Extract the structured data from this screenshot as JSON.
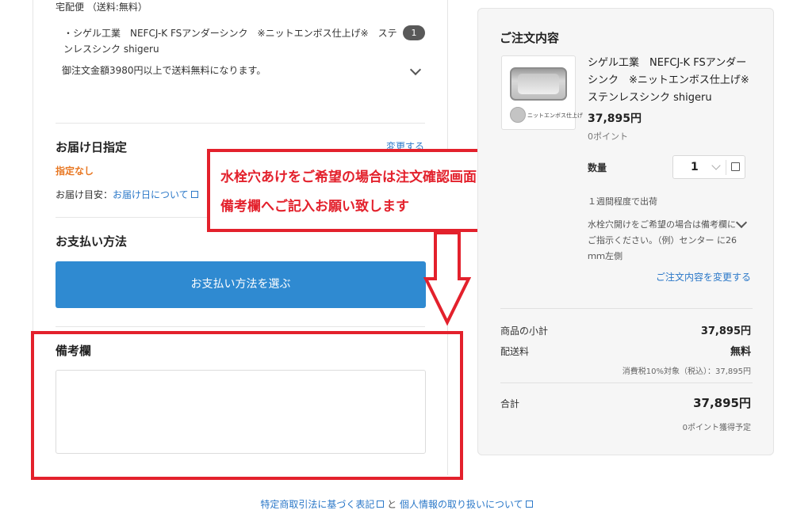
{
  "shipping": {
    "method": "宅配便 （送料:無料）",
    "item": "・シゲル工業　NEFCJ-K FSアンダーシンク　※ニットエンボス仕上げ※　ステンレスシンク shigeru",
    "item_qty": "1",
    "free_note": "御注文金額3980円以上で送料無料になります。"
  },
  "delivery": {
    "title": "お届け日指定",
    "change_label": "変更する",
    "status": "指定なし",
    "eta_label": "お届け目安：",
    "eta_link": "お届け日について"
  },
  "payment": {
    "title": "お支払い方法",
    "button_label": "お支払い方法を選ぶ"
  },
  "remarks": {
    "title": "備考欄",
    "value": ""
  },
  "annotation": {
    "line1": "水栓穴あけをご希望の場合は注文確認画面の",
    "line2": "備考欄へご記入お願い致します"
  },
  "order": {
    "title": "ご注文内容",
    "thumb_label": "ニットエンボス仕上げ",
    "product_name": "シゲル工業　NEFCJ-K FSアンダーシンク　※ニットエンボス仕上げ※　ステンレスシンク shigeru",
    "price": "37,895円",
    "points": "0ポイント",
    "qty_label": "数量",
    "qty_value": "1",
    "ship_time": "１週間程度で出荷",
    "faucet_note": "水栓穴開けをご希望の場合は備考欄にご指示ください。（例）センター に26ｍｍ左側",
    "edit_link": "ご注文内容を変更する",
    "subtotal_label": "商品の小計",
    "subtotal_value": "37,895円",
    "shipping_label": "配送料",
    "shipping_value": "無料",
    "tax_note": "消費税10%対象（税込）：37,895円",
    "total_label": "合計",
    "total_value": "37,895円",
    "earn_points": "0ポイント獲得予定"
  },
  "footer": {
    "link1": "特定商取引法に基づく表記",
    "joiner": "と",
    "link2": "個人情報の取り扱いについて"
  },
  "colors": {
    "accent": "#2f8ad1",
    "link": "#2b78c8",
    "annotation_red": "#e3212c",
    "warning_orange": "#e87722"
  }
}
